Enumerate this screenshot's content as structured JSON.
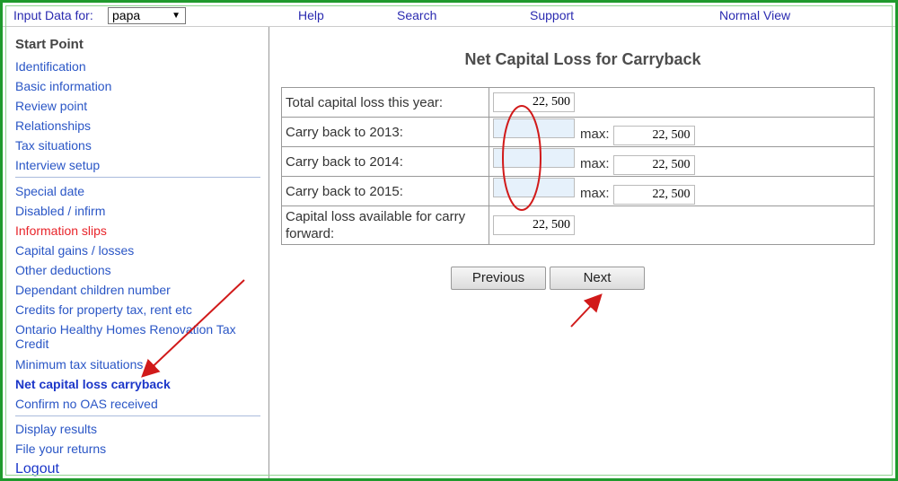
{
  "topbar": {
    "input_label": "Input Data for:",
    "profile_value": "papa",
    "help": "Help",
    "search": "Search",
    "support": "Support",
    "view": "Normal View"
  },
  "sidebar": {
    "start": "Start Point",
    "group1": [
      "Identification",
      "Basic information",
      "Review point",
      "Relationships",
      "Tax situations",
      "Interview setup"
    ],
    "group2": [
      "Special date",
      "Disabled / infirm",
      "Information slips",
      "Capital gains / losses",
      "Other deductions",
      "Dependant children number",
      "Credits for property tax, rent etc",
      "Ontario Healthy Homes Renovation Tax Credit",
      "Minimum tax situations",
      "Net capital loss carryback",
      "Confirm no OAS received"
    ],
    "group3": [
      "Display results",
      "File your returns"
    ],
    "logout": "Logout"
  },
  "main": {
    "title": "Net Capital Loss for Carryback",
    "rows": [
      {
        "label": "Total capital loss this year:",
        "value": "22, 500"
      },
      {
        "label": "Carry back to 2013:",
        "value": "",
        "max_label": "max:",
        "max": "22, 500"
      },
      {
        "label": "Carry back to 2014:",
        "value": "",
        "max_label": "max:",
        "max": "22, 500"
      },
      {
        "label": "Carry back to 2015:",
        "value": "",
        "max_label": "max:",
        "max": "22, 500"
      },
      {
        "label": "Capital loss available for carry forward:",
        "value": "22, 500"
      }
    ],
    "previous": "Previous",
    "next": "Next"
  },
  "annotations": {
    "color": "#d11a1a"
  }
}
